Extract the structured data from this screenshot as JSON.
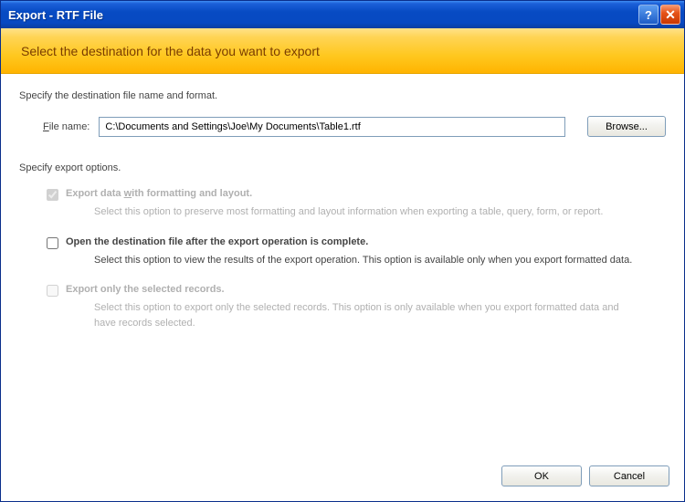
{
  "titlebar": {
    "title": "Export - RTF File",
    "help_icon": "?",
    "close_icon": "✕"
  },
  "header": {
    "text": "Select the destination for the data you want to export"
  },
  "dest_section_label": "Specify the destination file name and format.",
  "file": {
    "label_pre": "F",
    "label_post": "ile name:",
    "value": "C:\\Documents and Settings\\Joe\\My Documents\\Table1.rtf",
    "browse": "Browse..."
  },
  "options_section_label": "Specify export options.",
  "opt1": {
    "title_pre": "Export data ",
    "title_u": "w",
    "title_post": "ith formatting and layout.",
    "desc": "Select this option to preserve most formatting and layout information when exporting a table, query, form, or report."
  },
  "opt2": {
    "title": "Open the destination file after the export operation is complete.",
    "desc": "Select this option to view the results of the export operation. This option is available only when you export formatted data."
  },
  "opt3": {
    "title": "Export only the selected records.",
    "desc": "Select this option to export only the selected records. This option is only available when you export formatted data and have records selected."
  },
  "footer": {
    "ok": "OK",
    "cancel": "Cancel"
  }
}
